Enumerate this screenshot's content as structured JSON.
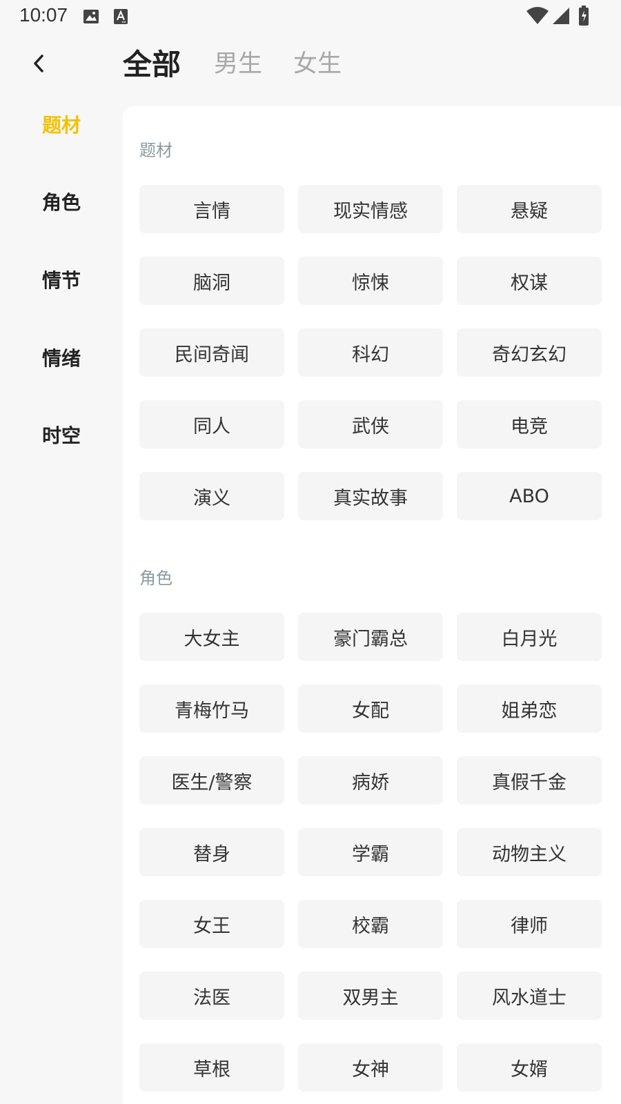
{
  "status_bar": {
    "time": "10:07"
  },
  "header": {
    "tabs": [
      {
        "label": "全部",
        "active": true
      },
      {
        "label": "男生",
        "active": false
      },
      {
        "label": "女生",
        "active": false
      }
    ]
  },
  "side_nav": {
    "items": [
      {
        "label": "题材",
        "active": true
      },
      {
        "label": "角色",
        "active": false
      },
      {
        "label": "情节",
        "active": false
      },
      {
        "label": "情绪",
        "active": false
      },
      {
        "label": "时空",
        "active": false
      }
    ]
  },
  "colors": {
    "accent": "#f5c000",
    "tag_background": "#f5f5f5",
    "section_title": "#8a9aa0"
  },
  "sections": [
    {
      "title": "题材",
      "tags": [
        "言情",
        "现实情感",
        "悬疑",
        "脑洞",
        "惊悚",
        "权谋",
        "民间奇闻",
        "科幻",
        "奇幻玄幻",
        "同人",
        "武侠",
        "电竞",
        "演义",
        "真实故事",
        "ABO"
      ]
    },
    {
      "title": "角色",
      "tags": [
        "大女主",
        "豪门霸总",
        "白月光",
        "青梅竹马",
        "女配",
        "姐弟恋",
        "医生/警察",
        "病娇",
        "真假千金",
        "替身",
        "学霸",
        "动物主义",
        "女王",
        "校霸",
        "律师",
        "法医",
        "双男主",
        "风水道士",
        "草根",
        "女神",
        "女婿"
      ]
    }
  ]
}
